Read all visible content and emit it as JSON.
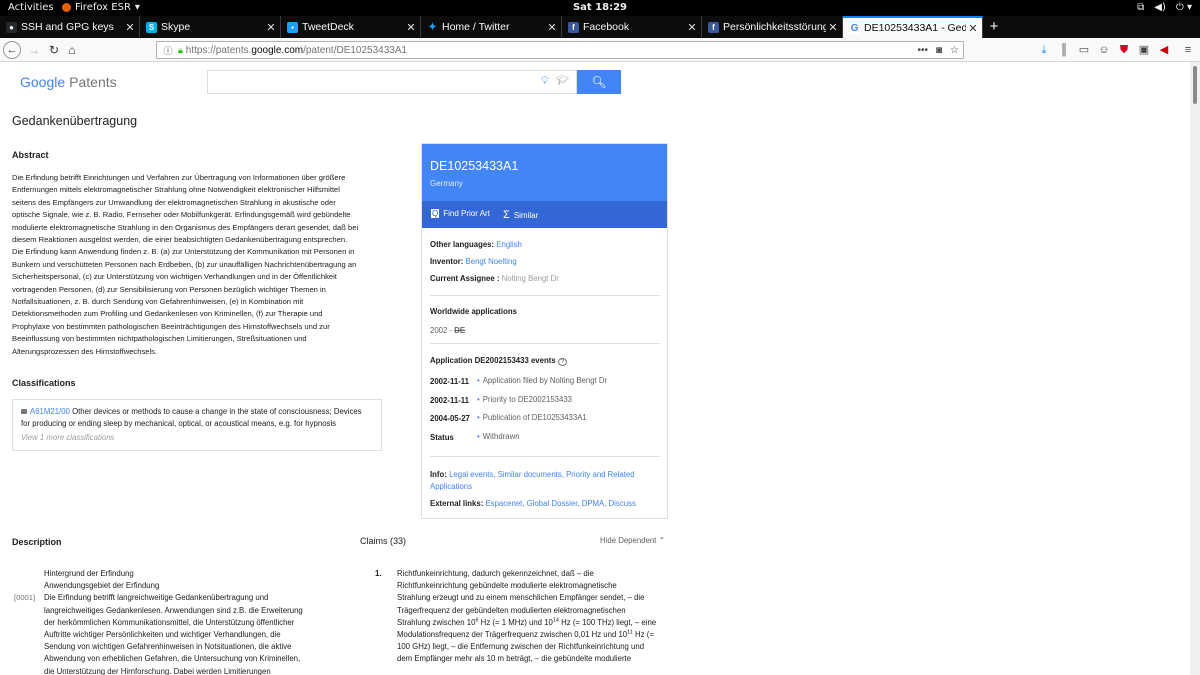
{
  "gnome": {
    "activities": "Activities",
    "app_name": "Firefox ESR",
    "clock": "Sat 18:29"
  },
  "tabs": [
    {
      "label": "SSH and GPG keys",
      "favicon": "github-icon",
      "color": "#24292e"
    },
    {
      "label": "Skype",
      "favicon": "skype-icon",
      "color": "#00aff0"
    },
    {
      "label": "TweetDeck",
      "favicon": "tweetdeck-icon",
      "color": "#1da1f2"
    },
    {
      "label": "Home / Twitter",
      "favicon": "twitter-icon",
      "color": "#1da1f2"
    },
    {
      "label": "Facebook",
      "favicon": "facebook-icon",
      "color": "#3b5998"
    },
    {
      "label": "Persönlichkeitsstörung / ...",
      "favicon": "facebook-icon",
      "color": "#3b5998"
    },
    {
      "label": "DE10253433A1 - Gedank...",
      "favicon": "google-icon",
      "color": "#4285f4",
      "active": true
    }
  ],
  "urlbar": {
    "prefix": "https://patents.",
    "domain": "google.com",
    "path": "/patent/DE10253433A1"
  },
  "header": {
    "logo_google": "Google",
    "logo_product": "Patents",
    "search_value": ""
  },
  "patent": {
    "title": "Gedankenübertragung",
    "abstract_heading": "Abstract",
    "abstract_lines": [
      "Die Erfindung betrifft Einrichtungen und Verfahren zur Übertragung von Informationen über größere",
      "Entfernungen mittels elektromagnetischer Strahlung ohne Notwendigkeit elektronischer Hilfsmittel",
      "seitens des Empfängers zur Umwandlung der elektromagnetischen Strahlung in akustische oder",
      "optische Signale, wie z. B. Radio, Fernseher oder Mobilfunkgerät. Erfindungsgemäß wird gebündelte",
      "modulierte elektromagnetische Strahlung in den Organismus des Empfängers derart gesendet, daß bei",
      "diesem Reaktionen ausgelöst werden, die einer beabsichtigten Gedankenübertragung entsprechen.",
      "Die Erfindung kann Anwendung finden z. B. (a) zur Unterstützung der Kommunikation mit Personen in",
      "Bunkern und verschütteten Personen nach Erdbeben, (b) zur unauffälligen Nachrichtenübertragung an",
      "Sicherheitspersonal, (c) zur Unterstützung von wichtigen Verhandlungen und in der Öffentlichkeit",
      "vortragenden Personen, (d) zur Sensibilisierung von Personen bezüglich wichtiger Themen in",
      "Notfallsituationen, z. B. durch Sendung von Gefahrenhinweisen, (e) in Kombination mit",
      "Detektionsmethoden zum Profiling und Gedankenlesen von Kriminellen, (f) zur Therapie und",
      "Prophylaxe von bestimmten pathologischen Beeinträchtigungen des Hirnstoffwechsels und zur",
      "Beeinflussung von bestimmten nichtpathologischen Limitierungen, Streßsituationen und",
      "Alterungsprozessen des Hirnstoffwechsels."
    ],
    "classifications_heading": "Classifications",
    "classification": {
      "code": "A61M21/00",
      "text_line1": "Other devices or methods to cause a change in the state of consciousness; Devices",
      "text_line2": "for producing or ending sleep by mechanical, optical, or acoustical means, e.g. for hypnosis",
      "more": "View 1 more classifications"
    },
    "description_heading": "Description",
    "description_lines": [
      "Hintergrund der Erfindung",
      "Anwendungsgebiet der Erfindung",
      "Die Erfindung betrifft langreichweitige Gedankenübertragung und",
      "langreichweitiges Gedankenlesen. Anwendungen sind z.B. die Erweiterung",
      "der herkömmlichen Kommunikationsmittel, die Unterstützung öffentlicher",
      "Auftritte wichtiger Persönlichkeiten und wichtiger Verhandlungen, die",
      "Sendung von wichtigen Gefahrenhinweisen in Notsituationen, die aktive",
      "Abwendung von erheblichen Gefahren, die Untersuchung von Kriminellen,",
      "die Unterstützung der Hirnforschung. Dabei werden Limitierungen"
    ],
    "para_number": "[0001]",
    "claims_heading": "Claims (33)",
    "hide_dependent": "Hide Dependent",
    "claim_number": "1.",
    "claim_lines": [
      "Richtfunkeinrichtung, dadurch gekennzeichnet, daß – die",
      "Richtfunkeinrichtung gebündelte modulierte elektromagnetische",
      "Strahlung erzeugt und zu einem menschlichen Empfänger sendet, – die",
      "Trägerfrequenz der gebündelten modulierten elektromagnetischen"
    ],
    "claim_line5": {
      "a": "Strahlung zwischen 10",
      "s1": "6",
      "b": " Hz (= 1 MHz) und 10",
      "s2": "14",
      "c": " Hz (= 100 THz) liegt, – eine"
    },
    "claim_line6": {
      "a": "Modulationsfrequenz der Trägerfrequenz zwischen 0,01 Hz und 10",
      "s1": "11",
      "b": " Hz (="
    },
    "claim_lines_end": [
      "100 GHz) liegt, – die Entfernung zwischen der Richtfunkeinrichtung und",
      "dem Empfänger mehr als 10 m beträgt, – die gebündelte modulierte"
    ]
  },
  "card": {
    "number": "DE10253433A1",
    "country": "Germany",
    "find_prior_art": "Find Prior Art",
    "similar": "Similar",
    "other_languages_label": "Other languages:",
    "other_languages_value": "English",
    "inventor_label": "Inventor:",
    "inventor_value": "Bengt Noelting",
    "assignee_label": "Current Assignee :",
    "assignee_value": "Nolting Bengt Dr",
    "worldwide_heading": "Worldwide applications",
    "worldwide_year": "2002",
    "worldwide_country": "DE",
    "events_heading": "Application DE2002153433 events",
    "events": [
      {
        "date": "2002-11-11",
        "text": "Application filed by Nolting Bengt Dr"
      },
      {
        "date": "2002-11-11",
        "text": "Priority to DE2002153433"
      },
      {
        "date": "2004-05-27",
        "text": "Publication of DE10253433A1"
      },
      {
        "date": "Status",
        "text": "Withdrawn"
      }
    ],
    "info_label": "Info:",
    "info_links_line1": "Legal events, Similar documents, Priority and Related",
    "info_links_line2": "Applications",
    "external_label": "External links:",
    "external_links": "Espacenet, Global Dossier, DPMA, Discuss"
  }
}
